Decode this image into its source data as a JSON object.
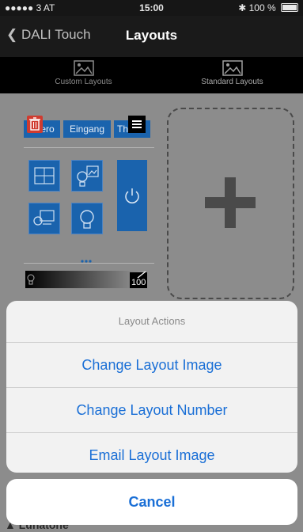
{
  "status_bar": {
    "carrier": "●●●●● 3 AT",
    "time": "15:00",
    "battery": "100 %"
  },
  "nav": {
    "back_label": "DALI Touch",
    "title": "Layouts"
  },
  "tabs": [
    {
      "label": "Custom Layouts"
    },
    {
      "label": "Standard Layouts"
    }
  ],
  "preview": {
    "scenes": [
      "ero",
      "Eingang",
      "Th"
    ],
    "slider_value": "100"
  },
  "action_sheet": {
    "title": "Layout Actions",
    "actions": [
      "Change Layout Image",
      "Change Layout Number",
      "Email Layout Image"
    ],
    "cancel": "Cancel"
  },
  "brand": "Lunatone",
  "colors": {
    "accent": "#1a6fd6",
    "tile_blue": "#1a63ad",
    "delete_red": "#d03b2f"
  }
}
